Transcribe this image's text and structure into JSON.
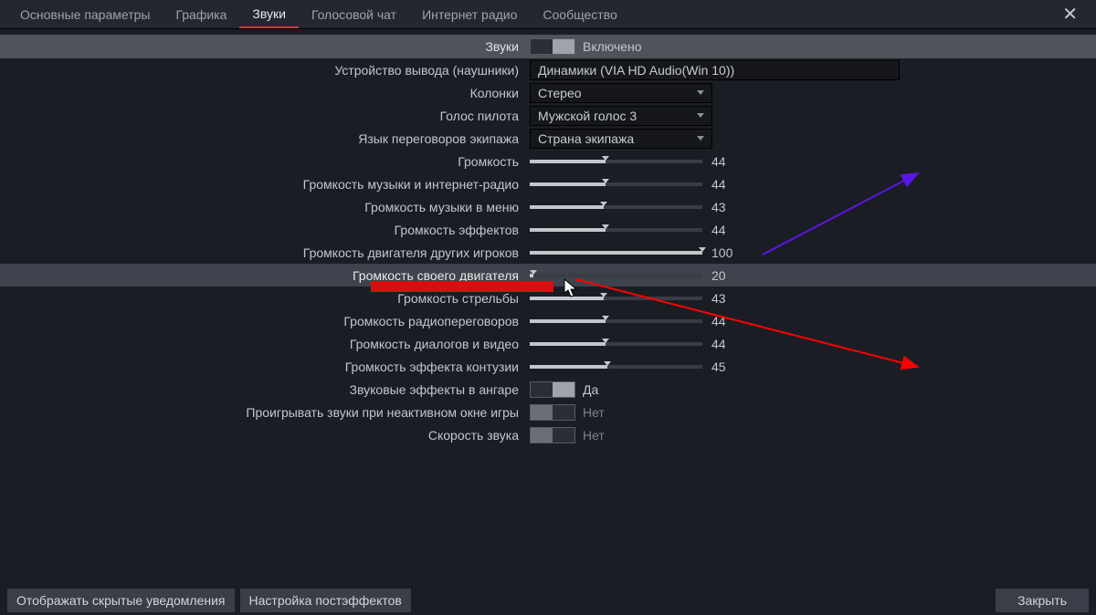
{
  "tabs": {
    "items": [
      "Основные параметры",
      "Графика",
      "Звуки",
      "Голосовой чат",
      "Интернет радио",
      "Сообщество"
    ],
    "active": 2
  },
  "header": {
    "label": "Звуки",
    "toggle_label": "Включено"
  },
  "rows": {
    "output_device": {
      "label": "Устройство вывода (наушники)",
      "value": "Динамики (VIA HD Audio(Win 10))"
    },
    "speakers": {
      "label": "Колонки",
      "value": "Стерео"
    },
    "pilot_voice": {
      "label": "Голос пилота",
      "value": "Мужской голос 3"
    },
    "crew_lang": {
      "label": "Язык переговоров экипажа",
      "value": "Страна экипажа"
    },
    "volume": {
      "label": "Громкость",
      "value": 44
    },
    "music_radio": {
      "label": "Громкость музыки и интернет-радио",
      "value": 44
    },
    "menu_music": {
      "label": "Громкость музыки в меню",
      "value": 43
    },
    "effects": {
      "label": "Громкость эффектов",
      "value": 44
    },
    "others_engine": {
      "label": "Громкость двигателя других игроков",
      "value": 100
    },
    "own_engine": {
      "label": "Громкость своего двигателя",
      "value": 20
    },
    "gunfire": {
      "label": "Громкость стрельбы",
      "value": 43
    },
    "radio": {
      "label": "Громкость радиопереговоров",
      "value": 44
    },
    "dialogs": {
      "label": "Громкость диалогов и видео",
      "value": 44
    },
    "concussion": {
      "label": "Громкость эффекта контузии",
      "value": 45
    },
    "hangar_fx": {
      "label": "Звуковые эффекты в ангаре",
      "value": "Да"
    },
    "inactive_window": {
      "label": "Проигрывать звуки при неактивном окне игры",
      "value": "Нет"
    },
    "sound_speed": {
      "label": "Скорость звука",
      "value": "Нет"
    }
  },
  "footer": {
    "hidden_notif": "Отображать скрытые уведомления",
    "posteffects": "Настройка постэффектов",
    "close": "Закрыть"
  }
}
